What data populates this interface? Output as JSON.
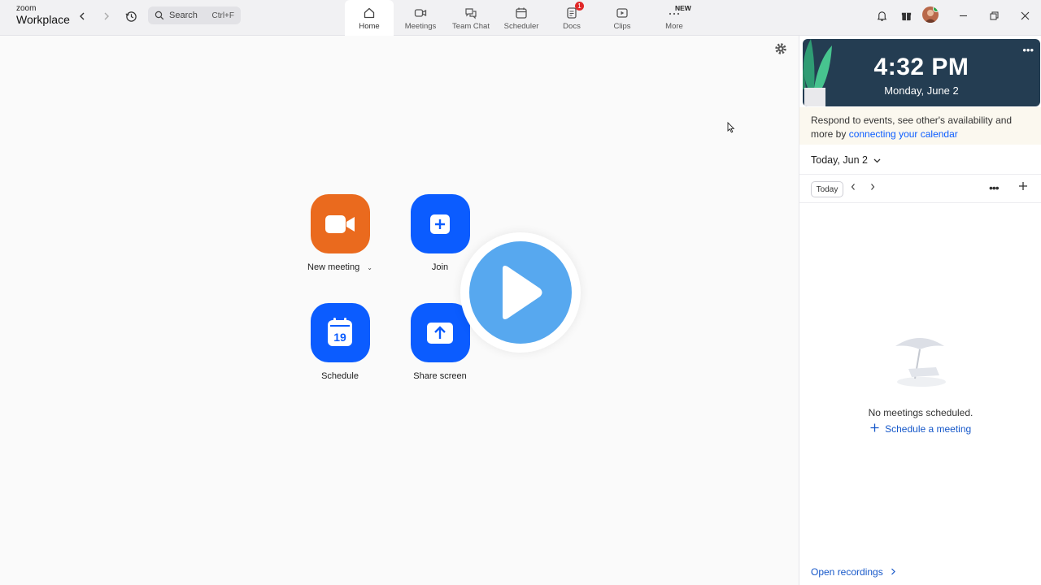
{
  "brand": {
    "line1": "zoom",
    "line2": "Workplace"
  },
  "search": {
    "placeholder": "Search",
    "shortcut": "Ctrl+F"
  },
  "tabs": [
    {
      "label": "Home",
      "icon": "home-icon"
    },
    {
      "label": "Meetings",
      "icon": "video-icon"
    },
    {
      "label": "Team Chat",
      "icon": "chat-icon"
    },
    {
      "label": "Scheduler",
      "icon": "calendar-icon"
    },
    {
      "label": "Docs",
      "icon": "docs-icon",
      "badge": "1"
    },
    {
      "label": "Clips",
      "icon": "clips-icon"
    },
    {
      "label": "More",
      "icon": "more-icon",
      "badge_text": "NEW"
    }
  ],
  "actions": {
    "new_meeting": "New meeting",
    "join": "Join",
    "schedule": "Schedule",
    "schedule_day": "19",
    "share_screen": "Share screen"
  },
  "panel": {
    "time": "4:32 PM",
    "date": "Monday, June 2",
    "note_text": "Respond to events, see other's availability and more by ",
    "note_link": "connecting your calendar",
    "day_header": "Today, Jun 2",
    "today_button": "Today",
    "empty_text": "No meetings scheduled.",
    "schedule_link": "Schedule a meeting",
    "footer_link": "Open recordings"
  },
  "colors": {
    "accent": "#0b5cff",
    "orange": "#ea6a1e",
    "clock_bg": "#243d52",
    "play": "#57a8ef"
  }
}
